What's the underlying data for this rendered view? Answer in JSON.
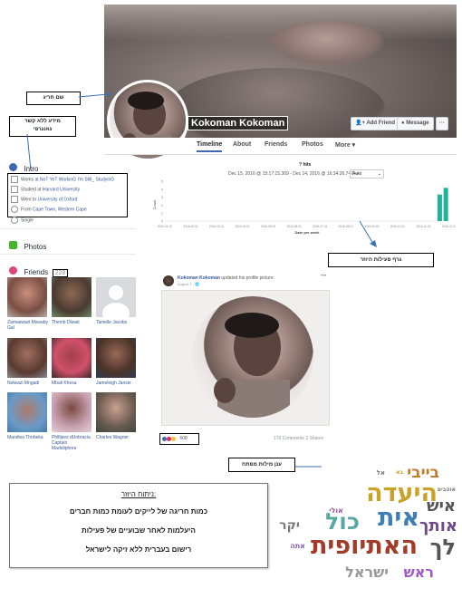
{
  "profile": {
    "name": "Kokoman Kokoman",
    "buttons": {
      "add_friend": "Add Friend",
      "message": "Message",
      "more": "···"
    }
  },
  "nav": {
    "tabs": [
      "Timeline",
      "About",
      "Friends",
      "Photos",
      "More ▾"
    ]
  },
  "callouts": {
    "nickname": "שם חריג",
    "no_location": [
      "מידע ללא קשר",
      "גאוגרפי"
    ],
    "activity_graph": "גרף פעילות היוזר",
    "word_cloud": "ענן מילות מפתח"
  },
  "intro": {
    "title": "Intro",
    "rows": [
      {
        "prefix": "Works at ",
        "link": "NoT YeT WorkinG I'm Still_ StudyinG"
      },
      {
        "prefix": "Studied at ",
        "link": "Harvard University"
      },
      {
        "prefix": "Went to ",
        "link": "University of Oxford"
      },
      {
        "prefix": "From ",
        "link": "Cape Town, Western Cape"
      },
      {
        "prefix": "Single",
        "link": ""
      }
    ]
  },
  "photos": {
    "title": "Photos"
  },
  "friends": {
    "title": "Friends",
    "count": "228",
    "list": [
      "Zamaswazi Mswaby Gal",
      "Themb Dlwati",
      "Tanielle Jacobs",
      "Nolwazi Mngadi",
      "Mbali Khesa",
      "Jameleigh Jansie",
      "Mandisa Thobeka",
      "Phillipes dUnbracia Captain Madoliphore",
      "Charles Wagner"
    ]
  },
  "chart_data": {
    "type": "bar",
    "title": "? hits",
    "subtitle": "Dec 15, 2016 @ 15:17:15.369 - Dec 14, 2016 @ 16:34:26.747 —",
    "interval": "Auto",
    "ylabel": "Count",
    "xlabel": "Date per week",
    "x": [
      "2016-01-10",
      "2016-02-01",
      "2016-03-01",
      "2016-04-01",
      "2016-05-01",
      "2016-06-01",
      "2016-07-01",
      "2016-08-01",
      "2016-09-01",
      "2016-10-01",
      "2016-11-01",
      "2016-12-01"
    ],
    "bars": [
      {
        "x": "2016-11-20",
        "value": 4,
        "color": "#1fb39a"
      },
      {
        "x": "2016-11-27",
        "value": 5,
        "color": "#1fb39a"
      }
    ],
    "ylim": [
      0,
      6
    ],
    "yticks": [
      "5",
      "4",
      "3",
      "2",
      "1",
      "0"
    ]
  },
  "post": {
    "author": "Kokoman Kokoman",
    "action": " updated his profile picture.",
    "time": "August 7 · 🌐",
    "reactions": "608",
    "stats": "170 Comments  3 Shares"
  },
  "word_cloud": {
    "words": [
      {
        "text": "היעדה",
        "color": "#c9a227"
      },
      {
        "text": "בייבי",
        "color": "#c07c2c"
      },
      {
        "text": "אית",
        "color": "#3f7db7"
      },
      {
        "text": "כול",
        "color": "#5aa7a0"
      },
      {
        "text": "האתיופית",
        "color": "#a23b2a"
      },
      {
        "text": "לך",
        "color": "#555555"
      },
      {
        "text": "ראש",
        "color": "#a05ac8"
      },
      {
        "text": "ישראל",
        "color": "#999999"
      },
      {
        "text": "איש",
        "color": "#555555"
      },
      {
        "text": "אותך",
        "color": "#6f4a8a"
      },
      {
        "text": "יקר",
        "color": "#777777"
      },
      {
        "text": "אתה",
        "color": "#8a64b6"
      },
      {
        "text": "אוהבים",
        "color": "#777777"
      },
      {
        "text": "אל",
        "color": "#777777"
      },
      {
        "text": "בא",
        "color": "#c9a227"
      },
      {
        "text": "אולי",
        "color": "#9a5aa0"
      }
    ]
  },
  "analysis": {
    "title": "ניתוח היוזר:",
    "lines": [
      "כמות חריגה של לייקים לעומת כמות חברים",
      "היעלמות לאחר שבועיים של פעילות",
      "רישום בעברית ללא זיקה לישראל"
    ]
  }
}
